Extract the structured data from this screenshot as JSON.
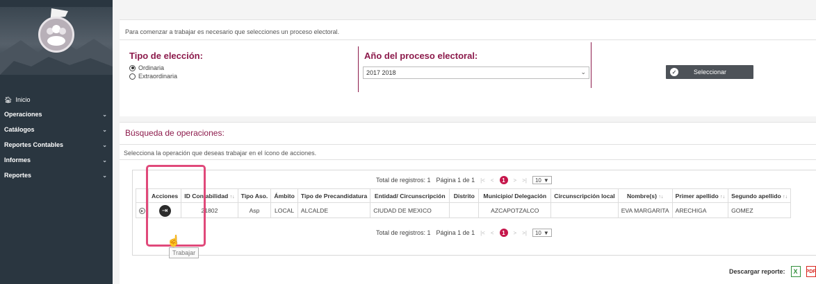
{
  "sidebar": {
    "items": [
      {
        "label": "Inicio",
        "icon": "home-icon"
      },
      {
        "label": "Operaciones",
        "icon": "chevron-down-icon"
      },
      {
        "label": "Catálogos",
        "icon": "chevron-down-icon"
      },
      {
        "label": "Reportes Contables",
        "icon": "chevron-down-icon"
      },
      {
        "label": "Informes",
        "icon": "chevron-down-icon"
      },
      {
        "label": "Reportes",
        "icon": "chevron-down-icon"
      }
    ]
  },
  "process": {
    "info": "Para comenzar a trabajar es necesario que selecciones un proceso electoral.",
    "tipo_title": "Tipo de elección:",
    "options": [
      "Ordinaria",
      "Extraordinaria"
    ],
    "selected_option": "Ordinaria",
    "anio_title": "Año del proceso electoral:",
    "anio_value": "2017 2018",
    "button_label": "Seleccionar"
  },
  "search": {
    "title": "Búsqueda de operaciones:",
    "instruction": "Selecciona la operación que deseas trabajar en el ícono de acciones.",
    "pager": {
      "total": "Total de registros: 1",
      "page": "Página 1 de 1",
      "current": "1",
      "page_size": "10"
    },
    "columns": [
      "Acciones",
      "ID Contabilidad",
      "Tipo Aso.",
      "Ámbito",
      "Tipo de Precandidatura",
      "Entidad/ Circunscripción",
      "Distrito",
      "Municipio/ Delegación",
      "Circunscripción local",
      "Nombre(s)",
      "Primer apellido",
      "Segundo apellido"
    ],
    "row": [
      "",
      "21802",
      "Asp",
      "LOCAL",
      "ALCALDE",
      "CIUDAD DE MEXICO",
      "",
      "AZCAPOTZALCO",
      "",
      "EVA MARGARITA",
      "ARECHIGA",
      "GOMEZ"
    ],
    "tooltip": "Trabajar"
  },
  "report": {
    "label": "Descargar reporte:"
  },
  "colors": {
    "sidebar": "#2a3640",
    "accent": "#8c1a4b",
    "highlight": "#e0497a",
    "page_active": "#c5164b"
  }
}
